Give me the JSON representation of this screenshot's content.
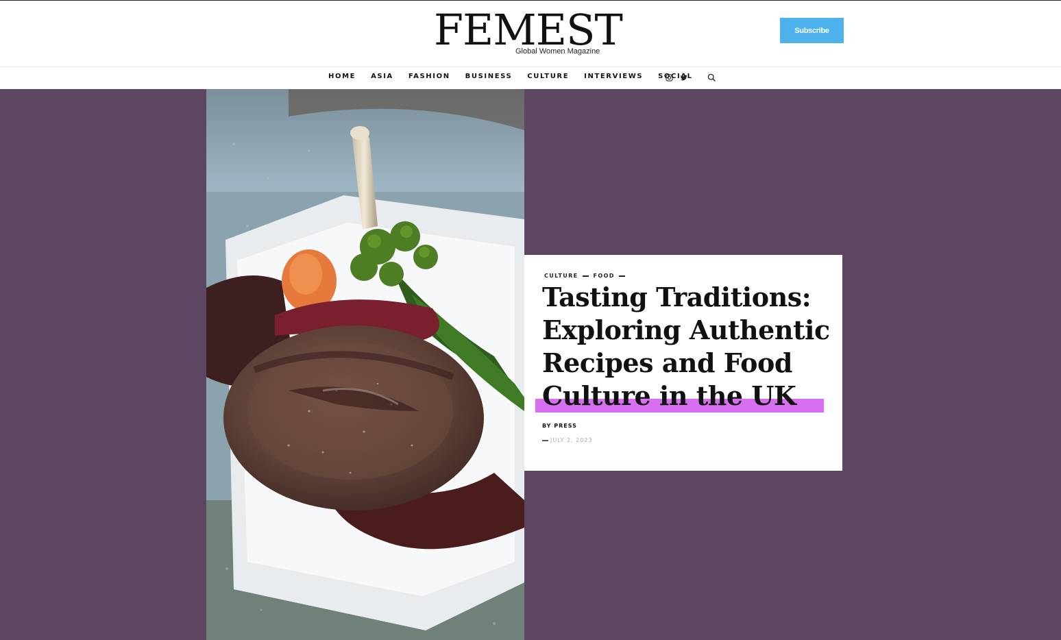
{
  "header": {
    "logo_title": "FEMEST",
    "logo_subtitle": "Global Women Magazine",
    "subscribe_label": "Subscribe"
  },
  "nav": {
    "items": [
      "HOME",
      "ASIA",
      "FASHION",
      "BUSINESS",
      "CULTURE",
      "INTERVIEWS",
      "SOCIAL"
    ],
    "social_icons": [
      "instagram-icon",
      "twitter-icon"
    ],
    "search_icon": "search-icon"
  },
  "hero": {
    "background_color": "#5d4661",
    "categories": [
      "CULTURE",
      "FOOD"
    ],
    "title_lines": [
      "Tasting Traditions:",
      "Exploring Authentic",
      "Recipes and Food",
      "Culture in the UK"
    ],
    "byline_prefix": "BY",
    "author": "PRESS",
    "date": "JULY 2, 2023",
    "highlight_color": "#d86ef0"
  },
  "colors": {
    "subscribe": "#4db2ec",
    "text": "#111111"
  }
}
